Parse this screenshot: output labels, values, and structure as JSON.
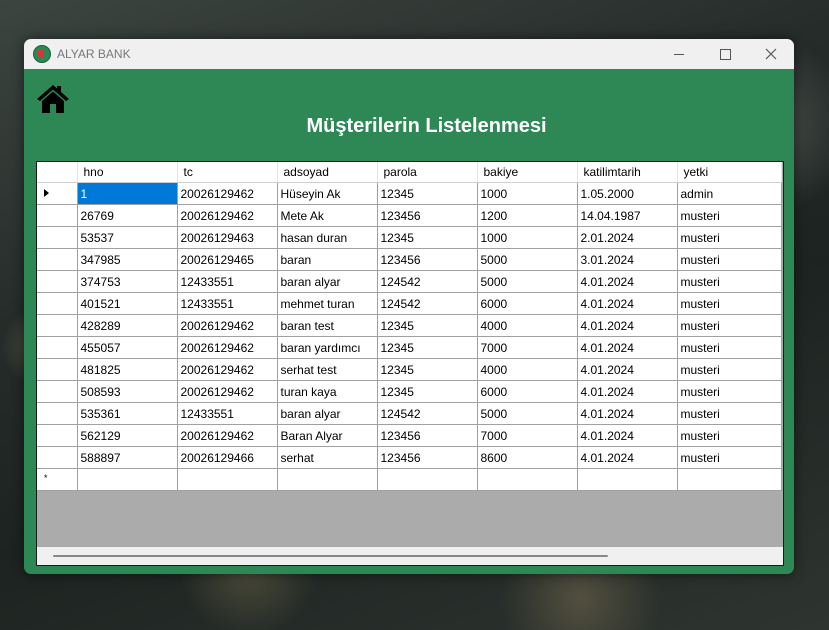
{
  "window": {
    "title": "ALYAR BANK",
    "accent_color": "#2d8856"
  },
  "page": {
    "home_icon": "home-icon",
    "title": "Müşterilerin Listelenmesi"
  },
  "table": {
    "columns": [
      "hno",
      "tc",
      "adsoyad",
      "parola",
      "bakiye",
      "katilimtarih",
      "yetki"
    ],
    "rows": [
      [
        "1",
        "20026129462",
        "Hüseyin Ak",
        "12345",
        "1000",
        "1.05.2000",
        "admin"
      ],
      [
        "26769",
        "20026129462",
        "Mete Ak",
        "123456",
        "1200",
        "14.04.1987",
        "musteri"
      ],
      [
        "53537",
        "20026129463",
        "hasan duran",
        "12345",
        "1000",
        "2.01.2024",
        "musteri"
      ],
      [
        "347985",
        "20026129465",
        "baran",
        "123456",
        "5000",
        "3.01.2024",
        "musteri"
      ],
      [
        "374753",
        "12433551",
        "baran alyar",
        "124542",
        "5000",
        "4.01.2024",
        "musteri"
      ],
      [
        "401521",
        "12433551",
        "mehmet turan",
        "124542",
        "6000",
        "4.01.2024",
        "musteri"
      ],
      [
        "428289",
        "20026129462",
        "baran test",
        "12345",
        "4000",
        "4.01.2024",
        "musteri"
      ],
      [
        "455057",
        "20026129462",
        "baran yardımcı",
        "12345",
        "7000",
        "4.01.2024",
        "musteri"
      ],
      [
        "481825",
        "20026129462",
        "serhat test",
        "12345",
        "4000",
        "4.01.2024",
        "musteri"
      ],
      [
        "508593",
        "20026129462",
        "turan kaya",
        "12345",
        "6000",
        "4.01.2024",
        "musteri"
      ],
      [
        "535361",
        "12433551",
        "baran alyar",
        "124542",
        "5000",
        "4.01.2024",
        "musteri"
      ],
      [
        "562129",
        "20026129462",
        "Baran Alyar",
        "123456",
        "7000",
        "4.01.2024",
        "musteri"
      ],
      [
        "588897",
        "20026129466",
        "serhat",
        "123456",
        "8600",
        "4.01.2024",
        "musteri"
      ]
    ],
    "selected_row": 0,
    "selected_col": 0,
    "new_row_marker": "*"
  }
}
